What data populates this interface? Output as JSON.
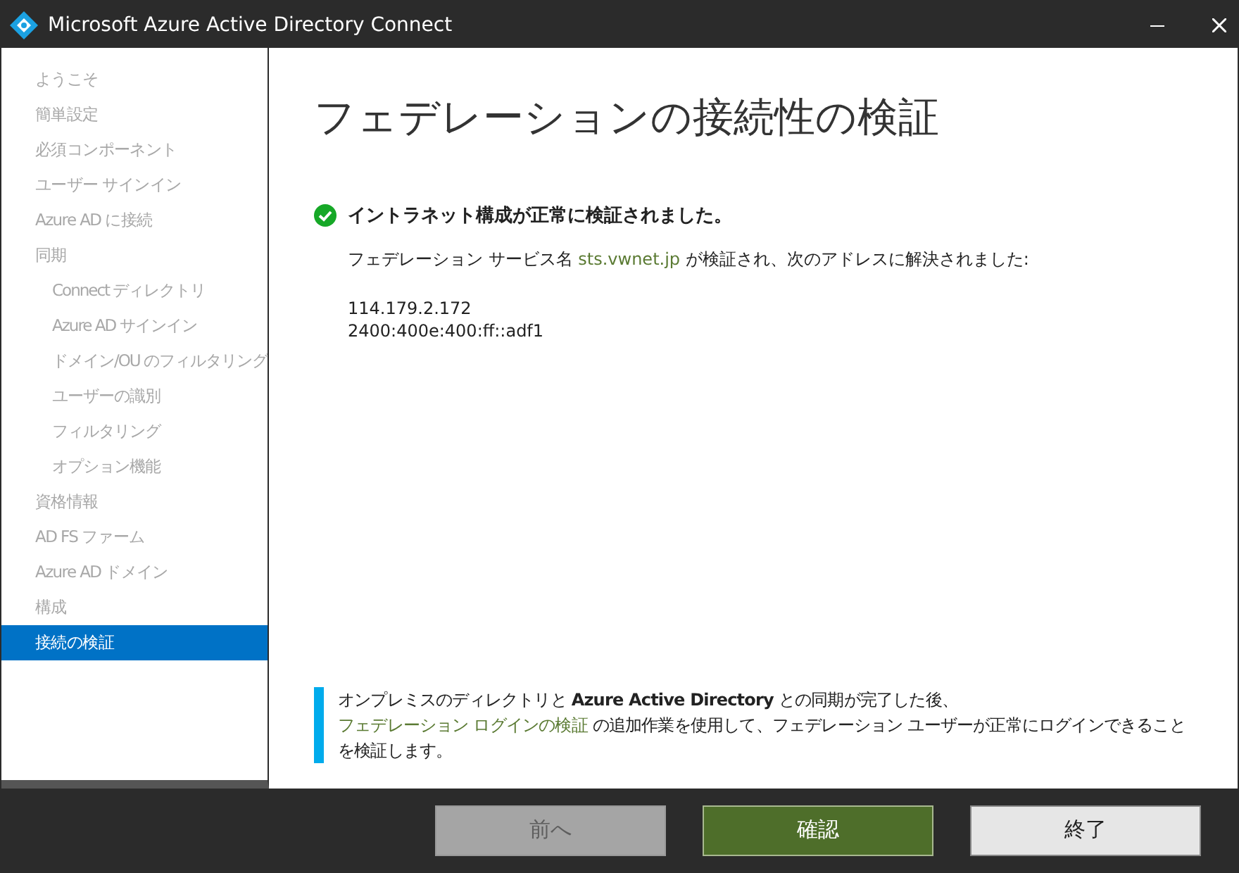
{
  "window": {
    "title": "Microsoft Azure Active Directory Connect"
  },
  "sidebar": {
    "items": [
      {
        "label": "ようこそ",
        "selected": false
      },
      {
        "label": "簡単設定",
        "selected": false
      },
      {
        "label": "必須コンポーネント",
        "selected": false
      },
      {
        "label": "ユーザー サインイン",
        "selected": false
      },
      {
        "label": "Azure AD に接続",
        "selected": false
      },
      {
        "label": "同期",
        "selected": false,
        "children": [
          {
            "label": "Connect ディレクトリ",
            "selected": false
          },
          {
            "label": "Azure AD サインイン",
            "selected": false
          },
          {
            "label": "ドメイン/OU のフィルタリング",
            "selected": false
          },
          {
            "label": "ユーザーの識別",
            "selected": false
          },
          {
            "label": "フィルタリング",
            "selected": false
          },
          {
            "label": "オプション機能",
            "selected": false
          }
        ]
      },
      {
        "label": "資格情報",
        "selected": false
      },
      {
        "label": "AD FS ファーム",
        "selected": false
      },
      {
        "label": "Azure AD ドメイン",
        "selected": false
      },
      {
        "label": "構成",
        "selected": false
      },
      {
        "label": "接続の検証",
        "selected": true
      }
    ]
  },
  "page": {
    "title": "フェデレーションの接続性の検証",
    "status": {
      "kind": "success",
      "text": "イントラネット構成が正常に検証されました。"
    },
    "detail": [
      {
        "kind": "text",
        "text": "フェデレーション サービス名 "
      },
      {
        "kind": "link",
        "text": "sts.vwnet.jp"
      },
      {
        "kind": "text",
        "text": " が検証され、次のアドレスに解決されました:"
      }
    ],
    "addresses": [
      "114.179.2.172",
      "2400:400e:400:ff::adf1"
    ],
    "note": [
      {
        "kind": "text",
        "text": "オンプレミスのディレクトリと **Azure Active Directory** との同期が完了した後、"
      },
      {
        "kind": "link",
        "text": "フェデレーション ログインの検証"
      },
      {
        "kind": "text",
        "text": " の追加作業を使用して、フェデレーション ユーザーが正常にログインできることを検証します。"
      }
    ]
  },
  "buttons": [
    {
      "label": "前へ",
      "kind": "secondary",
      "disabled": true
    },
    {
      "label": "確認",
      "kind": "primary",
      "disabled": false
    },
    {
      "label": "終了",
      "kind": "secondary",
      "disabled": false
    }
  ]
}
